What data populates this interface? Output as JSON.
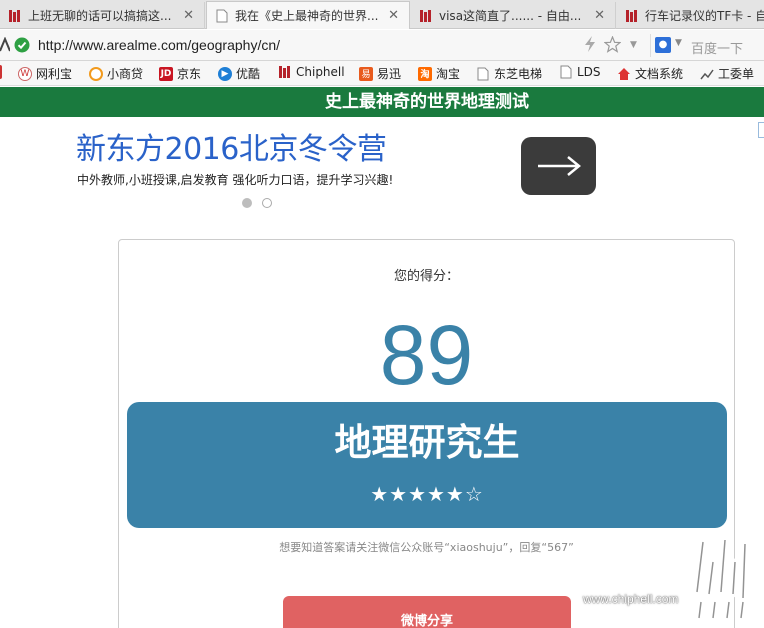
{
  "tabs": [
    {
      "title": "上班无聊的话可以搞搞这...",
      "close": "✕"
    },
    {
      "title": "我在《史上最神奇的世界...",
      "close": "✕"
    },
    {
      "title": "visa这简直了...... - 自由...",
      "close": "✕"
    },
    {
      "title": "行车记录仪的TF卡 - 自由"
    }
  ],
  "address": {
    "url": "http://www.arealme.com/geography/cn/",
    "search_placeholder": "百度一下"
  },
  "bookmarks": [
    {
      "label": "网利宝",
      "icon": "wanglibao-icon"
    },
    {
      "label": "小商贷",
      "icon": "xiaoshangdai-icon"
    },
    {
      "label": "京东",
      "icon": "jd-icon",
      "badge": "JD"
    },
    {
      "label": "优酷",
      "icon": "youku-icon"
    },
    {
      "label": "Chiphell",
      "icon": "chiphell-icon"
    },
    {
      "label": "易迅",
      "icon": "yixun-icon"
    },
    {
      "label": "淘宝",
      "icon": "taobao-icon",
      "badge": "淘"
    },
    {
      "label": "东芝电梯",
      "icon": "page-icon"
    },
    {
      "label": "LDS",
      "icon": "page-icon"
    },
    {
      "label": "文档系统",
      "icon": "home-icon"
    },
    {
      "label": "工委单",
      "icon": "chart-icon"
    }
  ],
  "page": {
    "banner_title": "史上最神奇的世界地理测试",
    "ad": {
      "title": "新东方2016北京冬令营",
      "subtitle": "中外教师,小班授课,启发教育 强化听力口语，提升学习兴趣!"
    },
    "score_label": "您的得分：",
    "score": "89",
    "rank": "地理研究生",
    "stars": "★★★★★☆",
    "note": "想要知道答案请关注微信公众账号“xiaoshuju”，回复“567”",
    "share_label": "微博分享"
  },
  "watermark": {
    "text": "www.chiphell.com"
  },
  "colors": {
    "banner": "#1a7a3e",
    "accent": "#3a82a8",
    "share": "#e06262",
    "ad_link": "#2a62c9"
  }
}
